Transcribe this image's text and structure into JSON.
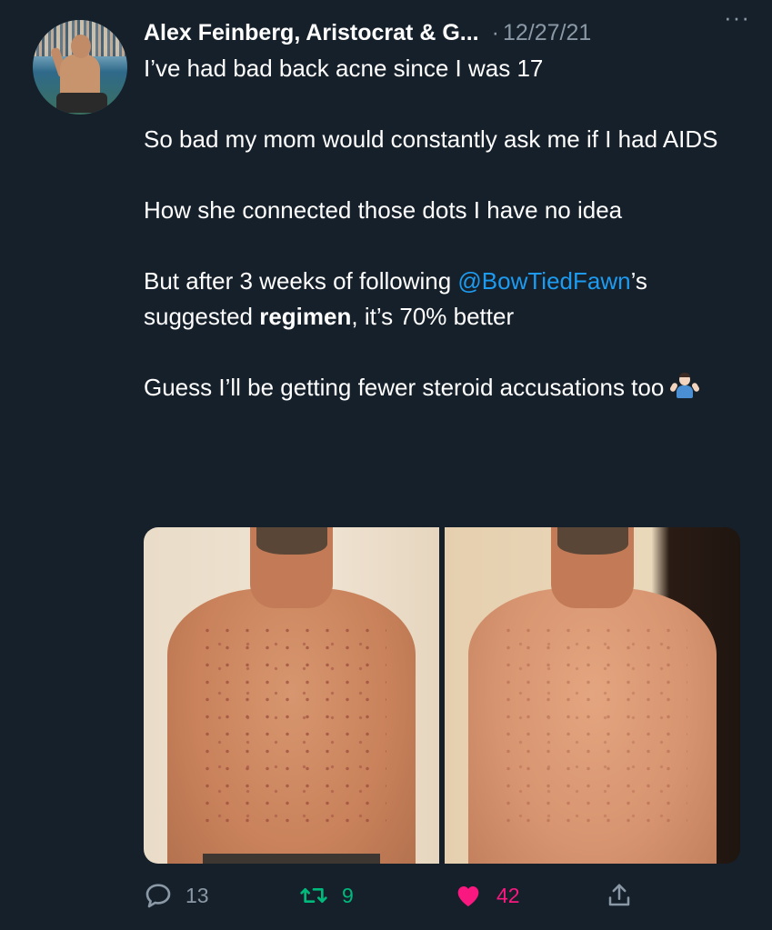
{
  "author": {
    "display_name": "Alex Feinberg, Aristocrat & G...",
    "date": "12/27/21"
  },
  "separator": "·",
  "more_label": "···",
  "tweet": {
    "line1": "I’ve had bad back acne since I was 17",
    "line2": "So bad my mom would constantly ask me if I had AIDS",
    "line3": "How she connected those dots I have no idea",
    "line4_prefix": "But after 3 weeks of following ",
    "mention": "@BowTiedFawn",
    "line4_mid": "’s suggested ",
    "line4_bold": "regimen",
    "line4_suffix": ", it’s 70% better",
    "line5": "Guess I’ll be getting fewer steroid accusations too"
  },
  "media": {
    "photos": [
      {
        "alt_icon": "back-photo-before"
      },
      {
        "alt_icon": "back-photo-after"
      }
    ]
  },
  "actions": {
    "reply_count": "13",
    "retweet_count": "9",
    "like_count": "42"
  },
  "colors": {
    "background": "#15202b",
    "secondary_text": "#8b98a5",
    "link": "#1d9bf0",
    "retweet": "#00ba7c",
    "like": "#f91880"
  }
}
